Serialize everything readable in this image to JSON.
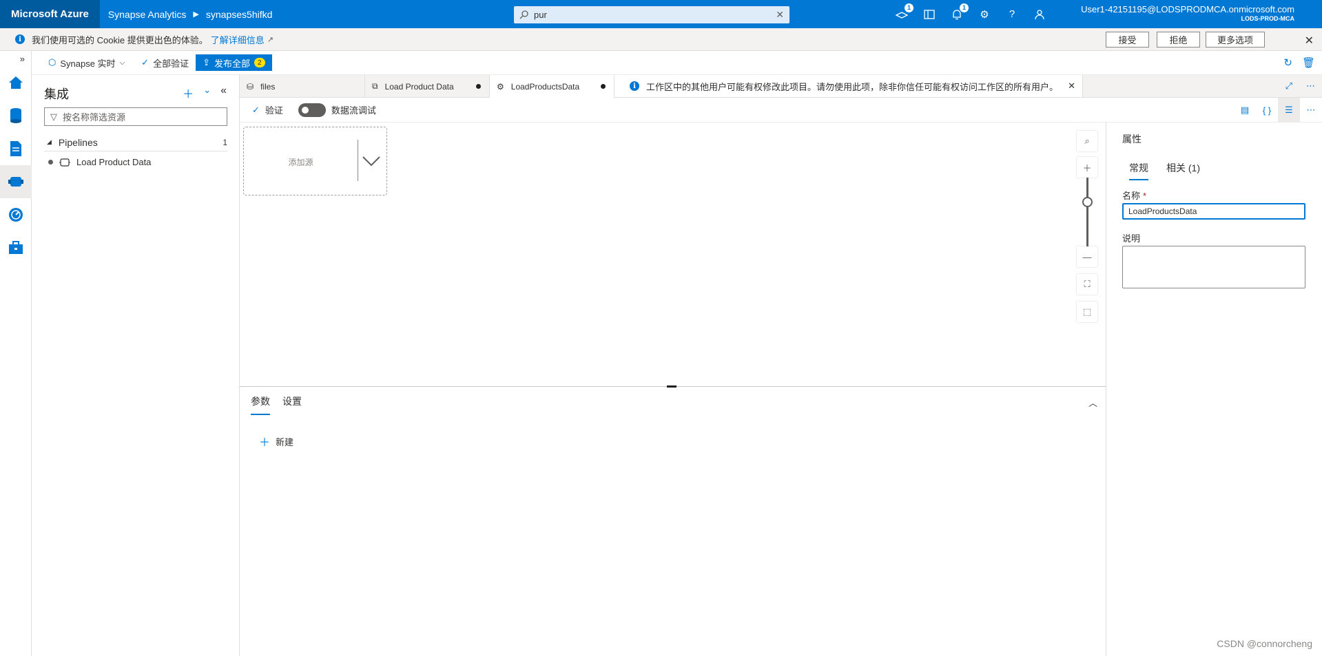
{
  "topbar": {
    "brand": "Microsoft Azure",
    "crumbs": [
      "Synapse Analytics",
      "synapses5hifkd"
    ],
    "search_value": "pur",
    "notif_badges": [
      "1",
      "1"
    ],
    "user_name": "User1-42151195@LODSPRODMCA.onmicrosoft.com",
    "user_tenant": "LODS-PROD-MCA"
  },
  "cookie": {
    "message": "我们使用可选的 Cookie 提供更出色的体验。",
    "link": "了解详细信息",
    "accept": "接受",
    "reject": "拒绝",
    "more": "更多选项"
  },
  "toolbar": {
    "synapse_live": "Synapse 实时",
    "validate_all": "全部验证",
    "publish_all": "发布全部",
    "publish_count": "2"
  },
  "leftpanel": {
    "title": "集成",
    "filter_placeholder": "按名称筛选资源",
    "section": "Pipelines",
    "section_count": "1",
    "item": "Load Product Data"
  },
  "tabs": {
    "items": [
      {
        "label": "files",
        "modified": false
      },
      {
        "label": "Load Product Data",
        "modified": true
      },
      {
        "label": "LoadProductsData",
        "modified": true
      }
    ],
    "info": "工作区中的其他用户可能有权修改此项目。请勿使用此项，除非你信任可能有权访问工作区的所有用户。"
  },
  "editor": {
    "validate": "验证",
    "debug_label": "数据流调试",
    "add_source": "添加源"
  },
  "bottom": {
    "tabs": [
      "参数",
      "设置"
    ],
    "new_label": "新建"
  },
  "properties": {
    "title": "属性",
    "tabs": [
      "常规",
      "相关 (1)"
    ],
    "name_label": "名称",
    "required_mark": "*",
    "name_value": "LoadProductsData",
    "desc_label": "说明"
  },
  "watermark": "CSDN @connorcheng",
  "colors": {
    "azure_blue": "#0078d4",
    "brand_dark": "#005a9e"
  }
}
